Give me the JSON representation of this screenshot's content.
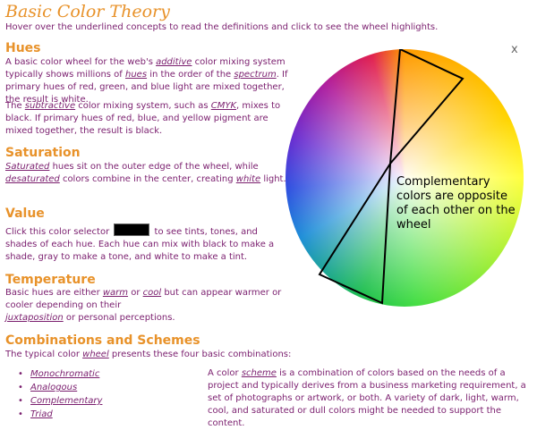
{
  "header": {
    "title": "Basic Color Theory",
    "instructions": "Hover over the underlined concepts to read the definitions and click to see the wheel highlights."
  },
  "close_label": "x",
  "sections": {
    "hues": {
      "heading": "Hues",
      "p1": {
        "t1": "A basic color wheel for the web's ",
        "additive": "additive",
        "t2": " color mixing system typically shows millions of ",
        "hues": "hues",
        "t3": " in the order of the ",
        "spectrum": "spectrum",
        "t4": ". If primary hues of red, green, and blue light are mixed together, the result is white."
      },
      "p2": {
        "t1": "The ",
        "subtractive": "subtractive",
        "t2": " color mixing system, such as ",
        "cmyk": "CMYK",
        "t3": ", mixes to black. If primary hues of red, blue, and yellow pigment are mixed together, the result is black."
      }
    },
    "saturation": {
      "heading": "Saturation",
      "saturated": "Saturated",
      "t1": " hues sit on the outer edge of the wheel, while ",
      "desaturated": "desaturated",
      "t2": " colors combine in the center, creating ",
      "white": "white",
      "t3": " light."
    },
    "value": {
      "heading": "Value",
      "t1": "Click this color selector ",
      "t2": " to see tints, tones, and shades of each hue. Each hue can mix with black to make a shade, gray to make a tone, and white to make a tint.",
      "selector_color": "#000000"
    },
    "temperature": {
      "heading": "Temperature",
      "t1": "Basic hues are either ",
      "warm": "warm",
      "t2": " or ",
      "cool": "cool",
      "t3": " but can appear warmer or cooler depending on their",
      "juxtaposition": "juxtaposition",
      "t4": " or personal perceptions."
    },
    "combinations": {
      "heading": "Combinations and Schemes",
      "t1": "The typical color ",
      "wheel": "wheel",
      "t2": " presents these four basic combinations:",
      "items": [
        "Monochromatic",
        "Analogous",
        "Complementary",
        "Triad"
      ],
      "scheme_t1": "A color ",
      "scheme": "scheme",
      "scheme_t2": " is a combination of colors based on the needs of a project and typically derives from a business marketing requirement, a set of photographs or artwork, or both. A variety of dark, light, warm, cool, and saturated or dull colors might be needed to support the content."
    }
  },
  "wheel": {
    "caption": "Complementary colors are opposite of each other on the wheel",
    "highlight": "Complementary"
  },
  "colors": {
    "heading": "#e8922a",
    "text": "#7a1e6e"
  }
}
